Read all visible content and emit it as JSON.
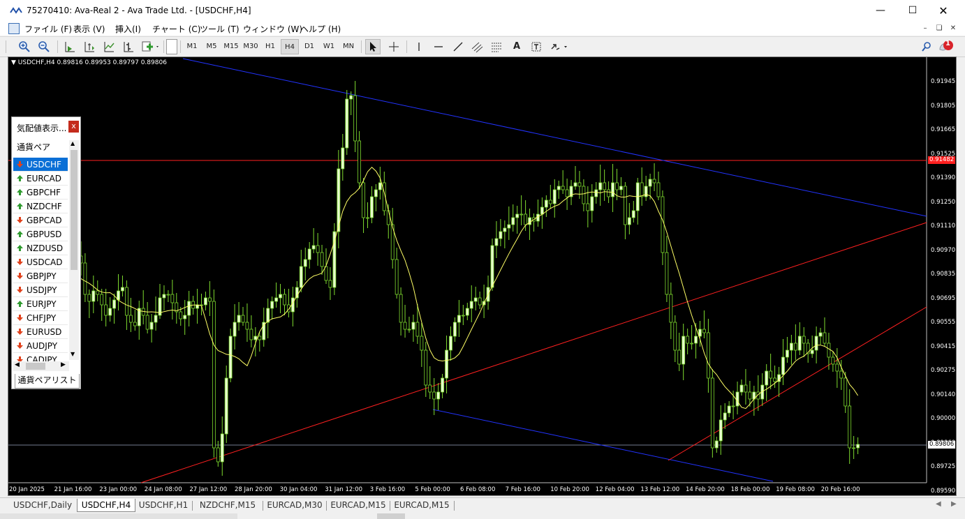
{
  "window": {
    "title": "75270410: Ava-Real 2 - Ava Trade Ltd. - [USDCHF,H4]"
  },
  "menu": [
    "ファイル (F)",
    "表示 (V)",
    "挿入(I)",
    "チャート (C)",
    "ツール (T)",
    "ウィンドウ (W)",
    "ヘルプ (H)"
  ],
  "toolbar": {
    "timeframes": [
      "M1",
      "M5",
      "M15",
      "M30",
      "H1",
      "H4",
      "D1",
      "W1",
      "MN"
    ],
    "active_timeframe": "H4",
    "text_tool": "A",
    "notification_count": "1"
  },
  "chart": {
    "info": "USDCHF,H4  0.89816 0.89953 0.89797 0.89806",
    "current_price": "0.89806",
    "hline_price": "0.91482",
    "y_ticks": [
      "0.91945",
      "0.91805",
      "0.91665",
      "0.91525",
      "0.91390",
      "0.91250",
      "0.91110",
      "0.90970",
      "0.90835",
      "0.90695",
      "0.90555",
      "0.90415",
      "0.90275",
      "0.90140",
      "0.90000",
      "0.89860",
      "0.89725",
      "0.89590"
    ],
    "x_ticks": [
      "20 Jan 2025",
      "21 Jan 16:00",
      "23 Jan 00:00",
      "24 Jan 08:00",
      "27 Jan 12:00",
      "28 Jan 20:00",
      "30 Jan 04:00",
      "31 Jan 12:00",
      "3 Feb 16:00",
      "5 Feb 00:00",
      "6 Feb 08:00",
      "7 Feb 16:00",
      "10 Feb 20:00",
      "12 Feb 04:00",
      "13 Feb 12:00",
      "14 Feb 20:00",
      "18 Feb 00:00",
      "19 Feb 08:00",
      "20 Feb 16:00"
    ],
    "colors": {
      "bull": "#e6ffcc",
      "bear": "#000000",
      "wick": "#7fdc2f",
      "ma": "#ffff66",
      "blue_line": "#2233ff",
      "red_line": "#ff2020",
      "grid_line": "#9aa6c0"
    }
  },
  "market_watch": {
    "title": "気配値表示...",
    "close": "x",
    "column_header": "通貨ペア",
    "symbols": [
      {
        "name": "USDCHF",
        "dir": "down",
        "selected": true
      },
      {
        "name": "EURCAD",
        "dir": "up"
      },
      {
        "name": "GBPCHF",
        "dir": "up"
      },
      {
        "name": "NZDCHF",
        "dir": "up"
      },
      {
        "name": "GBPCAD",
        "dir": "down"
      },
      {
        "name": "GBPUSD",
        "dir": "up"
      },
      {
        "name": "NZDUSD",
        "dir": "up"
      },
      {
        "name": "USDCAD",
        "dir": "down"
      },
      {
        "name": "GBPJPY",
        "dir": "down"
      },
      {
        "name": "USDJPY",
        "dir": "down"
      },
      {
        "name": "EURJPY",
        "dir": "up"
      },
      {
        "name": "CHFJPY",
        "dir": "down"
      },
      {
        "name": "EURUSD",
        "dir": "down"
      },
      {
        "name": "AUDJPY",
        "dir": "down"
      },
      {
        "name": "CADJPY",
        "dir": "down"
      }
    ],
    "bottom_tab": "通貨ペアリスト"
  },
  "chart_tabs": [
    "USDCHF,Daily",
    "USDCHF,H4",
    "USDCHF,H1",
    "NZDCHF,M15",
    "EURCAD,M30",
    "EURCAD,M15",
    "EURCAD,M15"
  ],
  "active_chart_tab": "USDCHF,H4"
}
